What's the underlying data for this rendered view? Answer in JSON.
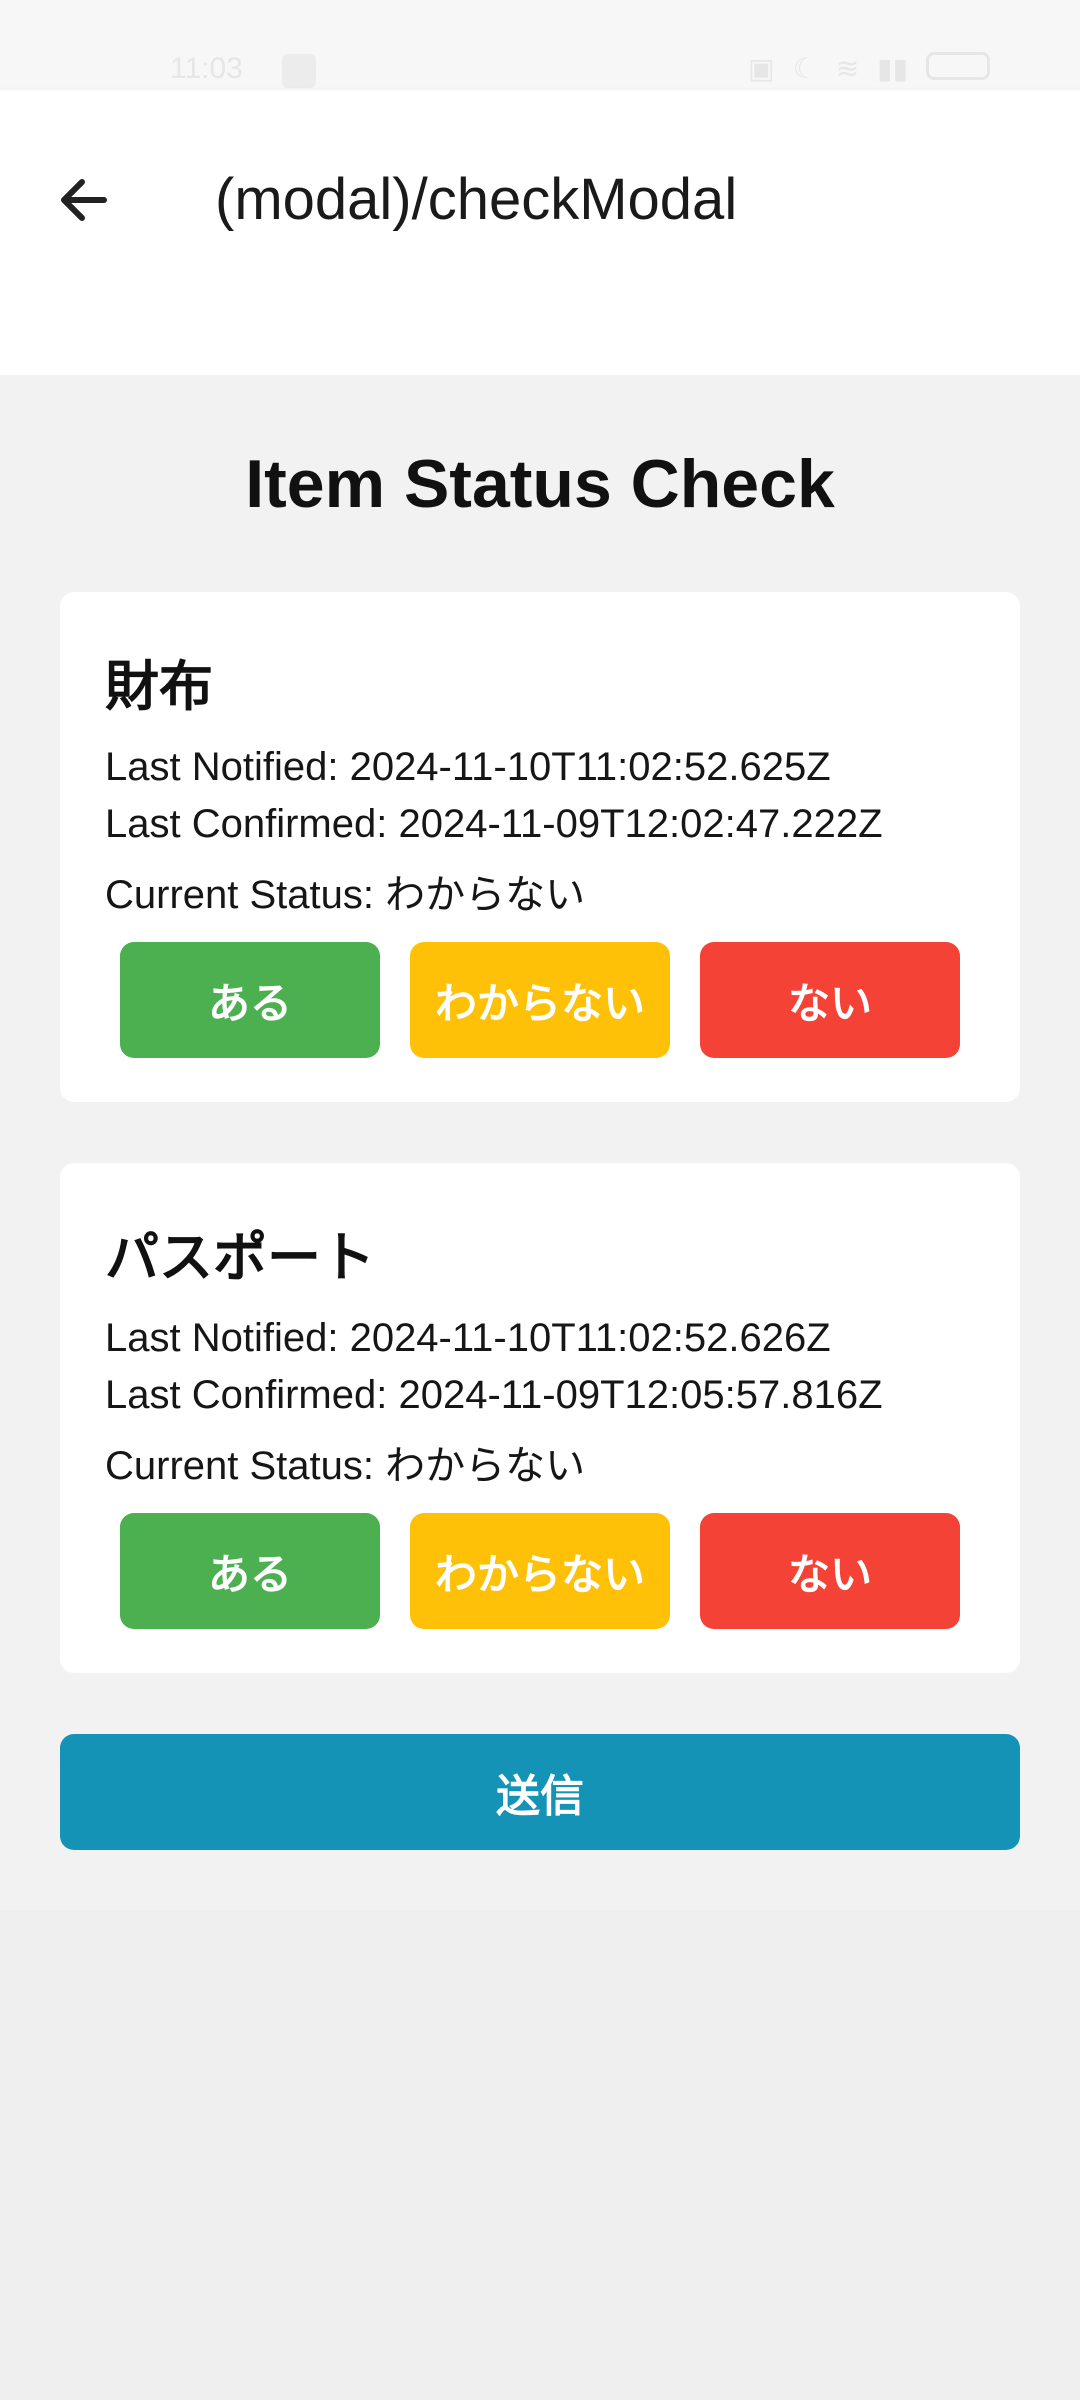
{
  "status_bar": {
    "time": "11:03"
  },
  "header": {
    "title": "(modal)/checkModal"
  },
  "page": {
    "title": "Item Status Check"
  },
  "items": [
    {
      "name": "財布",
      "last_notified": "Last Notified: 2024-11-10T11:02:52.625Z",
      "last_confirmed": "Last Confirmed: 2024-11-09T12:02:47.222Z",
      "current_status": "Current Status: わからない",
      "buttons": {
        "yes": "ある",
        "unknown": "わからない",
        "no": "ない"
      }
    },
    {
      "name": "パスポート",
      "last_notified": "Last Notified: 2024-11-10T11:02:52.626Z",
      "last_confirmed": "Last Confirmed: 2024-11-09T12:05:57.816Z",
      "current_status": "Current Status: わからない",
      "buttons": {
        "yes": "ある",
        "unknown": "わからない",
        "no": "ない"
      }
    }
  ],
  "submit": {
    "label": "送信"
  },
  "colors": {
    "yes": "#4caf50",
    "unknown": "#ffc107",
    "no": "#f44336",
    "submit": "#1493b6"
  }
}
